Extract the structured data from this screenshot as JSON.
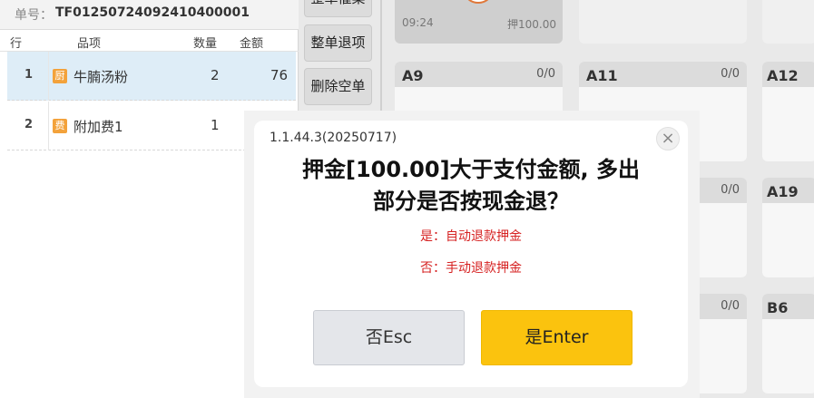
{
  "order": {
    "number_label": "单号：",
    "number": "TF01250724092410400001",
    "columns": {
      "row": "行",
      "item": "品项",
      "qty": "数量",
      "amount": "金额"
    },
    "items": [
      {
        "row": "1",
        "tag": "厨",
        "name": "牛腩汤粉",
        "qty": "2",
        "amount": "76"
      },
      {
        "row": "2",
        "tag": "费",
        "name": "附加费1",
        "qty": "1",
        "amount": ""
      }
    ]
  },
  "actions": {
    "top_partial": "整单催菜",
    "return_all": "整单退项",
    "delete_empty": "删除空单"
  },
  "tables": {
    "occupied": {
      "time": "09:24",
      "deposit": "押100.00"
    },
    "list": [
      {
        "name": "A9",
        "count": "0/0"
      },
      {
        "name": "A11",
        "count": "0/0"
      },
      {
        "name": "A12",
        "count": ""
      },
      {
        "name": "",
        "count": "0/0"
      },
      {
        "name": "A19",
        "count": ""
      },
      {
        "name": "",
        "count": "0/0"
      },
      {
        "name": "B6",
        "count": ""
      }
    ]
  },
  "dialog": {
    "version": "1.1.44.3(20250717)",
    "title_line1": "押金[100.00]大于支付金额, 多出",
    "title_line2": "部分是否按现金退？",
    "option_yes": "是：自动退款押金",
    "option_no": "否：手动退款押金",
    "no_button": "否Esc",
    "yes_button": "是Enter",
    "close_symbol": "×"
  },
  "colors": {
    "accent_yes": "#fbc30e",
    "option_text": "#d62222",
    "selected_row": "#deedf7",
    "item_tag": "#f3a23b"
  }
}
